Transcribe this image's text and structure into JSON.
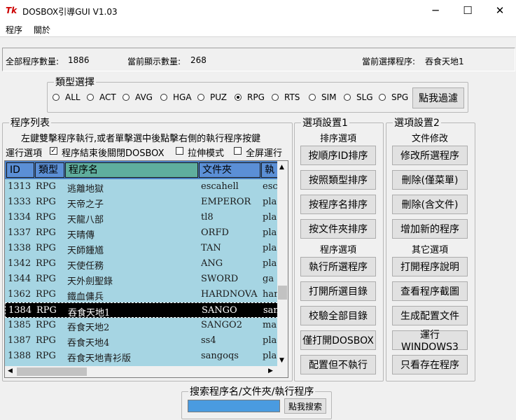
{
  "window": {
    "icon_text": "Tk",
    "title": "DOSBOX引導GUI V1.03",
    "minimize": "─",
    "maximize": "☐",
    "close": "✕"
  },
  "menu": {
    "items": [
      "程序",
      "關於"
    ]
  },
  "status": {
    "total_label": "全部程序數量:",
    "total_value": "1886",
    "shown_label": "當前顯示數量:",
    "shown_value": "268",
    "selected_label": "當前選擇程序:",
    "selected_value": "吞食天地1"
  },
  "type_select": {
    "title": "類型選擇",
    "options": [
      "ALL",
      "ACT",
      "AVG",
      "HGA",
      "PUZ",
      "RPG",
      "RTS",
      "SIM",
      "SLG",
      "SPG"
    ],
    "selected": "RPG",
    "filter_button": "點我過濾"
  },
  "program_list": {
    "title": "程序列表",
    "hint": "左鍵雙擊程序執行,或者單擊選中後點擊右側的執行程序按鍵",
    "run_options_label": "運行選項",
    "checkboxes": [
      {
        "label": "程序結束後關閉DOSBOX",
        "checked": true
      },
      {
        "label": "拉伸模式",
        "checked": false
      },
      {
        "label": "全屏運行",
        "checked": false
      }
    ],
    "columns": [
      "ID",
      "類型",
      "程序名",
      "文件夾",
      "執"
    ],
    "rows": [
      [
        "1313",
        "RPG",
        "逃離地獄",
        "escahell",
        "esc"
      ],
      [
        "1333",
        "RPG",
        "天帝之子",
        "EMPEROR",
        "pla"
      ],
      [
        "1334",
        "RPG",
        "天龍八部",
        "tl8",
        "pla"
      ],
      [
        "1337",
        "RPG",
        "天晴傳",
        "ORFD",
        "pla"
      ],
      [
        "1338",
        "RPG",
        "天師鍾馗",
        "TAN",
        "pla"
      ],
      [
        "1342",
        "RPG",
        "天使任務",
        "ANG",
        "pla"
      ],
      [
        "1344",
        "RPG",
        "天外劍聖錄",
        "SWORD",
        "ga"
      ],
      [
        "1362",
        "RPG",
        "鐵血傭兵",
        "HARDNOVA",
        "har"
      ],
      [
        "1384",
        "RPG",
        "吞食天地1",
        "SANGO",
        "san"
      ],
      [
        "1385",
        "RPG",
        "吞食天地2",
        "SANGO2",
        "ma"
      ],
      [
        "1387",
        "RPG",
        "吞食天地4",
        "ss4",
        "pla"
      ],
      [
        "1388",
        "RPG",
        "吞食天地青衫版",
        "sangoqs",
        "pla"
      ]
    ],
    "selected_index": 8
  },
  "settings1": {
    "title": "選項設置1",
    "sort_label": "排序選項",
    "sort_buttons": [
      "按順序ID排序",
      "按照類型排序",
      "按程序名排序",
      "按文件夾排序"
    ],
    "program_label": "程序選項",
    "program_buttons": [
      "執行所選程序",
      "打開所選目錄",
      "校驗全部目錄",
      "僅打開DOSBOX",
      "配置但不執行"
    ]
  },
  "settings2": {
    "title": "選項設置2",
    "file_label": "文件修改",
    "file_buttons": [
      "修改所選程序",
      "刪除(僅菜單)",
      "刪除(含文件)",
      "增加新的程序"
    ],
    "other_label": "其它選項",
    "other_buttons": [
      "打開程序說明",
      "查看程序截圖",
      "生成配置文件",
      "運行WINDOWS3",
      "只看存在程序"
    ]
  },
  "search": {
    "title": "搜索程序名/文件夾/執行程序",
    "value": "",
    "button": "點我搜索"
  }
}
